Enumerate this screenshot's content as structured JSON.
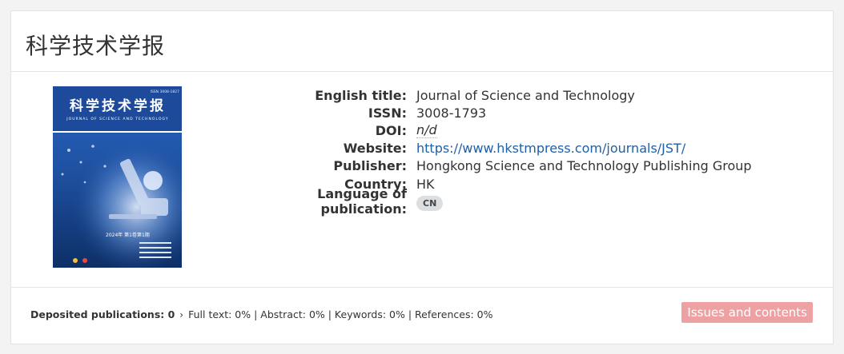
{
  "journal": {
    "title": "科学技术学报",
    "cover": {
      "title_cn": "科学技术学报",
      "title_en": "JOURNAL OF SCIENCE AND TECHNOLOGY",
      "issn_small": "ISSN 3008-1827",
      "issue": "2024年 第1卷第1期"
    },
    "meta": [
      {
        "label": "English title:",
        "value": "Journal of Science and Technology"
      },
      {
        "label": "ISSN:",
        "value": "3008-1793"
      },
      {
        "label": "DOI:",
        "value": "n/d"
      },
      {
        "label": "Website:",
        "value": "https://www.hkstmpress.com/journals/JST/"
      },
      {
        "label": "Publisher:",
        "value": "Hongkong Science and Technology Publishing Group"
      },
      {
        "label": "Country:",
        "value": "HK"
      },
      {
        "label": "Language of publication:",
        "value": "CN"
      }
    ]
  },
  "footer": {
    "deposited_label": "Deposited publications: 0",
    "chevron": "›",
    "stats": "Full text: 0% | Abstract: 0% | Keywords: 0% | References: 0%",
    "issues_button": "Issues and contents"
  },
  "colors": {
    "accent": "#eea1a3",
    "link": "#1f5fa8",
    "cover_blue": "#1a4a9c"
  }
}
